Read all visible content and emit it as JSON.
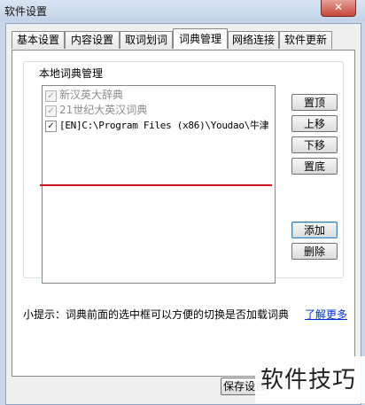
{
  "window": {
    "title": "软件设置",
    "close_glyph": "✕"
  },
  "tabs": [
    {
      "label": "基本设置"
    },
    {
      "label": "内容设置"
    },
    {
      "label": "取词划词"
    },
    {
      "label": "词典管理"
    },
    {
      "label": "网络连接"
    },
    {
      "label": "软件更新"
    }
  ],
  "active_tab": 3,
  "group": {
    "title": "本地词典管理",
    "items": [
      {
        "label": "新汉英大辞典",
        "checked": true,
        "enabled": false
      },
      {
        "label": "21世纪大英汉词典",
        "checked": true,
        "enabled": false
      },
      {
        "label": "[EN]C:\\Program Files (x86)\\Youdao\\牛津",
        "checked": true,
        "enabled": true
      }
    ],
    "buttons": {
      "top": "置顶",
      "up": "上移",
      "down": "下移",
      "bottom": "置底",
      "add": "添加",
      "delete": "删除"
    }
  },
  "tip": "小提示：词典前面的选中框可以方便的切换是否加载词典",
  "learn_more": "了解更多",
  "footer": {
    "save_label": "保存设置"
  },
  "watermark": "软件技巧",
  "colors": {
    "highlight_line": "#c8141d",
    "link": "#0033cc"
  }
}
